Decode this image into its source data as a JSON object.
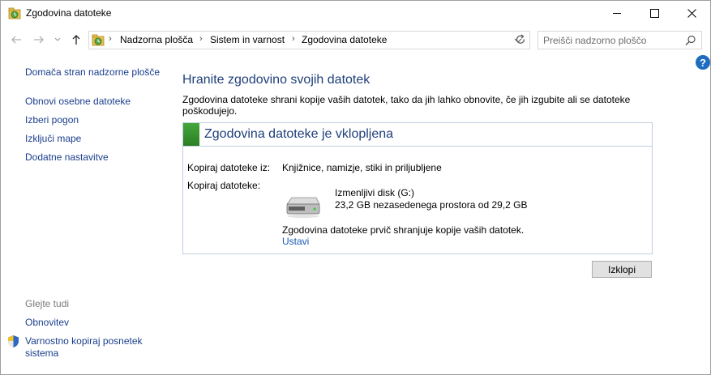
{
  "window": {
    "title": "Zgodovina datoteke"
  },
  "address": {
    "crumbs": [
      "Nadzorna plošča",
      "Sistem in varnost",
      "Zgodovina datoteke"
    ],
    "separator": "›"
  },
  "search": {
    "placeholder": "Preišči nadzorno ploščo"
  },
  "help": {
    "label": "?"
  },
  "sidebar": {
    "home": "Domača stran nadzorne plošče",
    "items": [
      {
        "label": "Obnovi osebne datoteke"
      },
      {
        "label": "Izberi pogon"
      },
      {
        "label": "Izključi mape"
      },
      {
        "label": "Dodatne nastavitve"
      }
    ],
    "see_also": "Glejte tudi",
    "see_also_items": [
      {
        "label": "Obnovitev"
      },
      {
        "label": "Varnostno kopiraj posnetek sistema"
      }
    ]
  },
  "main": {
    "title": "Hranite zgodovino svojih datotek",
    "description": "Zgodovina datoteke shrani kopije vaših datotek, tako da jih lahko obnovite, če jih izgubite ali se datoteke poškodujejo.",
    "panel": {
      "status": "Zgodovina datoteke je vklopljena",
      "status_color": "#3a9a31",
      "copy_from_label": "Kopiraj datoteke iz:",
      "copy_from_value": "Knjižnice, namizje, stiki in priljubljene",
      "copy_to_label": "Kopiraj datoteke:",
      "drive_name": "Izmenljivi disk (G:)",
      "drive_space": "23,2 GB nezasedenega prostora od 29,2 GB",
      "first_copy_msg": "Zgodovina datoteke prvič shranjuje kopije vaših datotek.",
      "stop_link": "Ustavi"
    },
    "off_button": "Izklopi"
  },
  "colors": {
    "heading": "#1e3f7a",
    "link": "#1a3e8c",
    "accent_green": "#3a9a31"
  }
}
